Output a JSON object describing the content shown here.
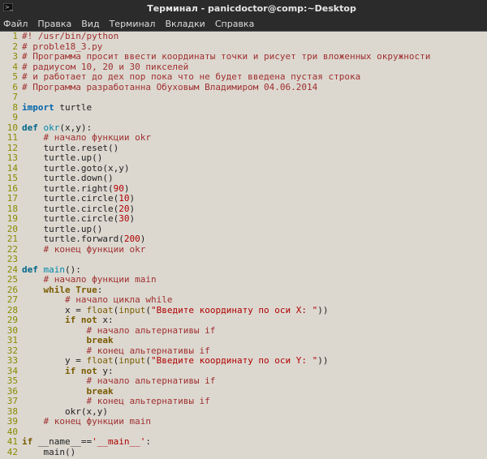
{
  "window": {
    "title": "Терминал - panicdoctor@comp:~Desktop"
  },
  "menu": {
    "file": "Файл",
    "edit": "Правка",
    "view": "Вид",
    "terminal": "Терминал",
    "tabs": "Вкладки",
    "help": "Справка"
  },
  "lines": [
    {
      "n": "1",
      "segs": [
        {
          "cls": "c-comment",
          "t": "#! /usr/bin/python"
        }
      ]
    },
    {
      "n": "2",
      "segs": [
        {
          "cls": "c-comment",
          "t": "# proble18_3.py"
        }
      ]
    },
    {
      "n": "3",
      "segs": [
        {
          "cls": "c-comment",
          "t": "# Программа просит ввести координаты точки и рисует три вложенных окружности"
        }
      ]
    },
    {
      "n": "4",
      "segs": [
        {
          "cls": "c-comment",
          "t": "# радиусом 10, 20 и 30 пикселей"
        }
      ]
    },
    {
      "n": "5",
      "segs": [
        {
          "cls": "c-comment",
          "t": "# и работает до дех пор пока что не будет введена пустая строка"
        }
      ]
    },
    {
      "n": "6",
      "segs": [
        {
          "cls": "c-comment",
          "t": "# Программа разработанна Обуховым Владимиром 04.06.2014"
        }
      ]
    },
    {
      "n": "7",
      "segs": [
        {
          "cls": "",
          "t": ""
        }
      ]
    },
    {
      "n": "8",
      "segs": [
        {
          "cls": "c-kw",
          "t": "import"
        },
        {
          "cls": "",
          "t": " turtle"
        }
      ]
    },
    {
      "n": "9",
      "segs": [
        {
          "cls": "",
          "t": ""
        }
      ]
    },
    {
      "n": "10",
      "segs": [
        {
          "cls": "c-def",
          "t": "def"
        },
        {
          "cls": "",
          "t": " "
        },
        {
          "cls": "c-fn",
          "t": "okr"
        },
        {
          "cls": "",
          "t": "(x,y):"
        }
      ]
    },
    {
      "n": "11",
      "segs": [
        {
          "cls": "",
          "t": "    "
        },
        {
          "cls": "c-comment",
          "t": "# начало функции okr"
        }
      ]
    },
    {
      "n": "12",
      "segs": [
        {
          "cls": "",
          "t": "    turtle.reset()"
        }
      ]
    },
    {
      "n": "13",
      "segs": [
        {
          "cls": "",
          "t": "    turtle.up()"
        }
      ]
    },
    {
      "n": "14",
      "segs": [
        {
          "cls": "",
          "t": "    turtle.goto(x,y)"
        }
      ]
    },
    {
      "n": "15",
      "segs": [
        {
          "cls": "",
          "t": "    turtle.down()"
        }
      ]
    },
    {
      "n": "16",
      "segs": [
        {
          "cls": "",
          "t": "    turtle.right("
        },
        {
          "cls": "c-num",
          "t": "90"
        },
        {
          "cls": "",
          "t": ")"
        }
      ]
    },
    {
      "n": "17",
      "segs": [
        {
          "cls": "",
          "t": "    turtle.circle("
        },
        {
          "cls": "c-num",
          "t": "10"
        },
        {
          "cls": "",
          "t": ")"
        }
      ]
    },
    {
      "n": "18",
      "segs": [
        {
          "cls": "",
          "t": "    turtle.circle("
        },
        {
          "cls": "c-num",
          "t": "20"
        },
        {
          "cls": "",
          "t": ")"
        }
      ]
    },
    {
      "n": "19",
      "segs": [
        {
          "cls": "",
          "t": "    turtle.circle("
        },
        {
          "cls": "c-num",
          "t": "30"
        },
        {
          "cls": "",
          "t": ")"
        }
      ]
    },
    {
      "n": "20",
      "segs": [
        {
          "cls": "",
          "t": "    turtle.up()"
        }
      ]
    },
    {
      "n": "21",
      "segs": [
        {
          "cls": "",
          "t": "    turtle.forward("
        },
        {
          "cls": "c-num",
          "t": "200"
        },
        {
          "cls": "",
          "t": ")"
        }
      ]
    },
    {
      "n": "22",
      "segs": [
        {
          "cls": "",
          "t": "    "
        },
        {
          "cls": "c-comment",
          "t": "# конец функции okr"
        }
      ]
    },
    {
      "n": "23",
      "segs": [
        {
          "cls": "",
          "t": ""
        }
      ]
    },
    {
      "n": "24",
      "segs": [
        {
          "cls": "c-def",
          "t": "def"
        },
        {
          "cls": "",
          "t": " "
        },
        {
          "cls": "c-fn",
          "t": "main"
        },
        {
          "cls": "",
          "t": "():"
        }
      ]
    },
    {
      "n": "25",
      "segs": [
        {
          "cls": "",
          "t": "    "
        },
        {
          "cls": "c-comment",
          "t": "# начало функции main"
        }
      ]
    },
    {
      "n": "26",
      "segs": [
        {
          "cls": "",
          "t": "    "
        },
        {
          "cls": "c-kw2",
          "t": "while"
        },
        {
          "cls": "",
          "t": " "
        },
        {
          "cls": "c-bool",
          "t": "True"
        },
        {
          "cls": "",
          "t": ":"
        }
      ]
    },
    {
      "n": "27",
      "segs": [
        {
          "cls": "",
          "t": "        "
        },
        {
          "cls": "c-comment",
          "t": "# начало цикла while"
        }
      ]
    },
    {
      "n": "28",
      "segs": [
        {
          "cls": "",
          "t": "        x = "
        },
        {
          "cls": "c-builtin",
          "t": "float"
        },
        {
          "cls": "",
          "t": "("
        },
        {
          "cls": "c-builtin",
          "t": "input"
        },
        {
          "cls": "",
          "t": "("
        },
        {
          "cls": "c-str",
          "t": "\"Введите координату по оси X: \""
        },
        {
          "cls": "",
          "t": "))"
        }
      ]
    },
    {
      "n": "29",
      "segs": [
        {
          "cls": "",
          "t": "        "
        },
        {
          "cls": "c-kw2",
          "t": "if"
        },
        {
          "cls": "",
          "t": " "
        },
        {
          "cls": "c-kw2",
          "t": "not"
        },
        {
          "cls": "",
          "t": " x:"
        }
      ]
    },
    {
      "n": "30",
      "segs": [
        {
          "cls": "",
          "t": "            "
        },
        {
          "cls": "c-comment",
          "t": "# начало альтернативы if"
        }
      ]
    },
    {
      "n": "31",
      "segs": [
        {
          "cls": "",
          "t": "            "
        },
        {
          "cls": "c-kw2",
          "t": "break"
        }
      ]
    },
    {
      "n": "32",
      "segs": [
        {
          "cls": "",
          "t": "            "
        },
        {
          "cls": "c-comment",
          "t": "# конец альтернативы if"
        }
      ]
    },
    {
      "n": "33",
      "segs": [
        {
          "cls": "",
          "t": "        y = "
        },
        {
          "cls": "c-builtin",
          "t": "float"
        },
        {
          "cls": "",
          "t": "("
        },
        {
          "cls": "c-builtin",
          "t": "input"
        },
        {
          "cls": "",
          "t": "("
        },
        {
          "cls": "c-str",
          "t": "\"Введите координату по оси Y: \""
        },
        {
          "cls": "",
          "t": "))"
        }
      ]
    },
    {
      "n": "34",
      "segs": [
        {
          "cls": "",
          "t": "        "
        },
        {
          "cls": "c-kw2",
          "t": "if"
        },
        {
          "cls": "",
          "t": " "
        },
        {
          "cls": "c-kw2",
          "t": "not"
        },
        {
          "cls": "",
          "t": " y:"
        }
      ]
    },
    {
      "n": "35",
      "segs": [
        {
          "cls": "",
          "t": "            "
        },
        {
          "cls": "c-comment",
          "t": "# начало альтернативы if"
        }
      ]
    },
    {
      "n": "36",
      "segs": [
        {
          "cls": "",
          "t": "            "
        },
        {
          "cls": "c-kw2",
          "t": "break"
        }
      ]
    },
    {
      "n": "37",
      "segs": [
        {
          "cls": "",
          "t": "            "
        },
        {
          "cls": "c-comment",
          "t": "# конец альтернативы if"
        }
      ]
    },
    {
      "n": "38",
      "segs": [
        {
          "cls": "",
          "t": "        okr(x,y) "
        }
      ]
    },
    {
      "n": "39",
      "segs": [
        {
          "cls": "",
          "t": "    "
        },
        {
          "cls": "c-comment",
          "t": "# конец функции main"
        }
      ]
    },
    {
      "n": "40",
      "segs": [
        {
          "cls": "",
          "t": ""
        }
      ]
    },
    {
      "n": "41",
      "segs": [
        {
          "cls": "c-kw2",
          "t": "if"
        },
        {
          "cls": "",
          "t": " __name__=="
        },
        {
          "cls": "c-str",
          "t": "'__main__'"
        },
        {
          "cls": "",
          "t": ":"
        }
      ]
    },
    {
      "n": "42",
      "segs": [
        {
          "cls": "",
          "t": "    main()"
        }
      ]
    }
  ]
}
